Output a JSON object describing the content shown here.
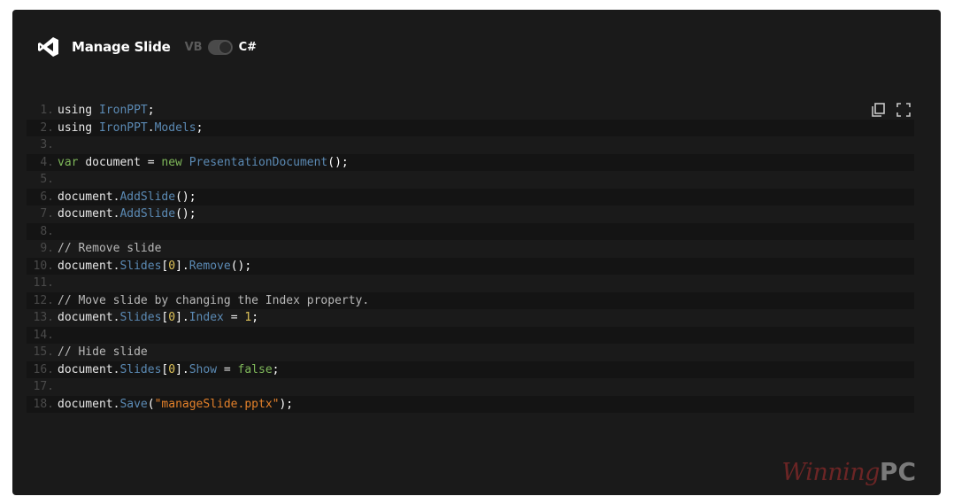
{
  "header": {
    "title": "Manage Slide",
    "lang_vb": "VB",
    "lang_cs": "C#"
  },
  "code_lines": [
    {
      "num": "1.",
      "tokens": [
        [
          "txt",
          "using "
        ],
        [
          "c-type",
          "IronPPT"
        ],
        [
          "c-punc",
          ";"
        ]
      ]
    },
    {
      "num": "2.",
      "tokens": [
        [
          "txt",
          "using "
        ],
        [
          "c-type",
          "IronPPT"
        ],
        [
          "txt",
          "."
        ],
        [
          "c-type",
          "Models"
        ],
        [
          "c-punc",
          ";"
        ]
      ]
    },
    {
      "num": "3.",
      "tokens": []
    },
    {
      "num": "4.",
      "tokens": [
        [
          "c-key",
          "var "
        ],
        [
          "txt",
          "document = "
        ],
        [
          "c-key",
          "new "
        ],
        [
          "c-type",
          "PresentationDocument"
        ],
        [
          "c-punc",
          "();"
        ]
      ]
    },
    {
      "num": "5.",
      "tokens": []
    },
    {
      "num": "6.",
      "tokens": [
        [
          "txt",
          "document."
        ],
        [
          "c-type",
          "AddSlide"
        ],
        [
          "c-punc",
          "();"
        ]
      ]
    },
    {
      "num": "7.",
      "tokens": [
        [
          "txt",
          "document."
        ],
        [
          "c-type",
          "AddSlide"
        ],
        [
          "c-punc",
          "();"
        ]
      ]
    },
    {
      "num": "8.",
      "tokens": []
    },
    {
      "num": "9.",
      "tokens": [
        [
          "c-cmt",
          "// Remove slide"
        ]
      ]
    },
    {
      "num": "10.",
      "tokens": [
        [
          "txt",
          "document."
        ],
        [
          "c-type",
          "Slides"
        ],
        [
          "c-punc",
          "["
        ],
        [
          "c-num",
          "0"
        ],
        [
          "c-punc",
          "]."
        ],
        [
          "c-type",
          "Remove"
        ],
        [
          "c-punc",
          "();"
        ]
      ]
    },
    {
      "num": "11.",
      "tokens": []
    },
    {
      "num": "12.",
      "tokens": [
        [
          "c-cmt",
          "// Move slide by changing the Index property."
        ]
      ]
    },
    {
      "num": "13.",
      "tokens": [
        [
          "txt",
          "document."
        ],
        [
          "c-type",
          "Slides"
        ],
        [
          "c-punc",
          "["
        ],
        [
          "c-num",
          "0"
        ],
        [
          "c-punc",
          "]."
        ],
        [
          "c-type",
          "Index"
        ],
        [
          "txt",
          " = "
        ],
        [
          "c-num",
          "1"
        ],
        [
          "c-punc",
          ";"
        ]
      ]
    },
    {
      "num": "14.",
      "tokens": []
    },
    {
      "num": "15.",
      "tokens": [
        [
          "c-cmt",
          "// Hide slide"
        ]
      ]
    },
    {
      "num": "16.",
      "tokens": [
        [
          "txt",
          "document."
        ],
        [
          "c-type",
          "Slides"
        ],
        [
          "c-punc",
          "["
        ],
        [
          "c-num",
          "0"
        ],
        [
          "c-punc",
          "]."
        ],
        [
          "c-type",
          "Show"
        ],
        [
          "txt",
          " = "
        ],
        [
          "c-key",
          "false"
        ],
        [
          "c-punc",
          ";"
        ]
      ]
    },
    {
      "num": "17.",
      "tokens": []
    },
    {
      "num": "18.",
      "tokens": [
        [
          "txt",
          "document."
        ],
        [
          "c-type",
          "Save"
        ],
        [
          "c-punc",
          "("
        ],
        [
          "c-str",
          "\"manageSlide.pptx\""
        ],
        [
          "c-punc",
          ");"
        ]
      ]
    }
  ],
  "icons": {
    "app": "visual-studio-icon",
    "copy": "copy-icon",
    "fullscreen": "fullscreen-icon"
  },
  "watermark": {
    "part1": "Winning",
    "part2": "PC"
  },
  "colors": {
    "panel_bg": "#1a1a1a",
    "type": "#5b8ab4",
    "keyword": "#7fb85a",
    "string": "#e4812a",
    "number": "#e0c45a",
    "line_number": "#4a4a4a"
  }
}
